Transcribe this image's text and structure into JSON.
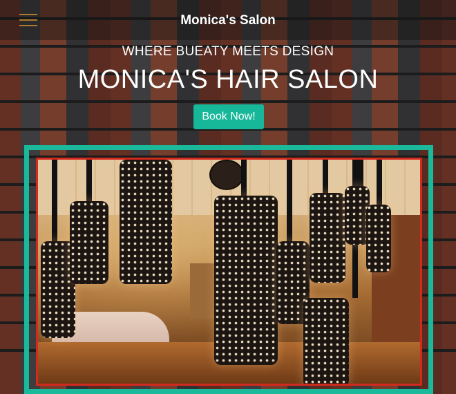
{
  "navbar": {
    "menu_icon": "hamburger-menu-icon",
    "brand": "Monica's Salon"
  },
  "hero": {
    "tagline": "WHERE BUEATY MEETS DESIGN",
    "headline": "MONICA'S HAIR SALON",
    "button_label": "Book Now!"
  },
  "image": {
    "subject": "salon-interior-with-pendant-lamps"
  },
  "colors": {
    "accent": "#17b79a",
    "frame_outer": "#1bb99b",
    "frame_inner": "#d42a1e",
    "menu_icon": "#b07a2e"
  }
}
